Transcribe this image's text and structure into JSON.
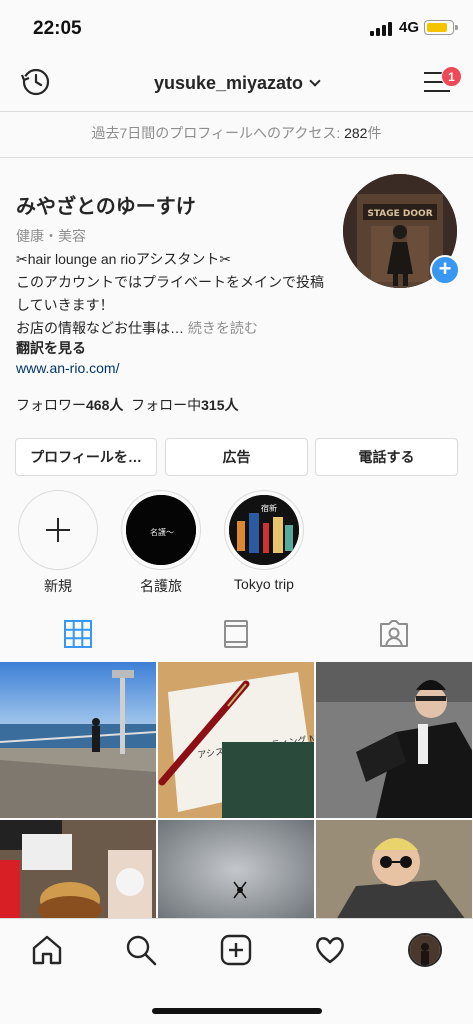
{
  "status": {
    "time": "22:05",
    "network": "4G",
    "battery_level": 0.85
  },
  "header": {
    "username": "yusuke_miyazato",
    "notification_count": "1"
  },
  "insight": {
    "prefix": "過去7日間のプロフィールへのアクセス: ",
    "count": "282",
    "suffix": "件"
  },
  "profile": {
    "display_name": "みやざとのゆーすけ",
    "category": "健康・美容",
    "bio_line1": "✂hair lounge an rioアシスタント✂",
    "bio_line2": "このアカウントではプライベートをメインで投稿",
    "bio_line3": "していきます！",
    "bio_line4": "お店の情報などお仕事は… ",
    "more": "続きを読む",
    "translate": "翻訳を見る",
    "website": "www.an-rio.com/",
    "followers_label": "フォロワー",
    "followers": "468人",
    "following_label": "フォロー中",
    "following": "315人"
  },
  "buttons": {
    "edit_profile": "プロフィールを…",
    "promotions": "広告",
    "call": "電話する"
  },
  "highlights": [
    {
      "label": "新規",
      "icon": "plus-icon"
    },
    {
      "label": "名護旅",
      "cover_text": "名護〜"
    },
    {
      "label": "Tokyo trip",
      "cover_text": "宿新"
    }
  ],
  "tabs": [
    {
      "name": "grid-view",
      "icon": "grid-icon",
      "active": true
    },
    {
      "name": "igtv",
      "icon": "tv-icon",
      "active": false
    },
    {
      "name": "tagged",
      "icon": "tagged-person-icon",
      "active": false
    }
  ],
  "posts": {
    "notebook_text": "アシスタント ミーティング NOTE"
  },
  "colors": {
    "accent": "#3897f0",
    "badge": "#ed4956",
    "link": "#003569",
    "muted": "#8e8e8e"
  },
  "nav": [
    "home-icon",
    "search-icon",
    "new-post-icon",
    "heart-icon",
    "profile-avatar"
  ]
}
